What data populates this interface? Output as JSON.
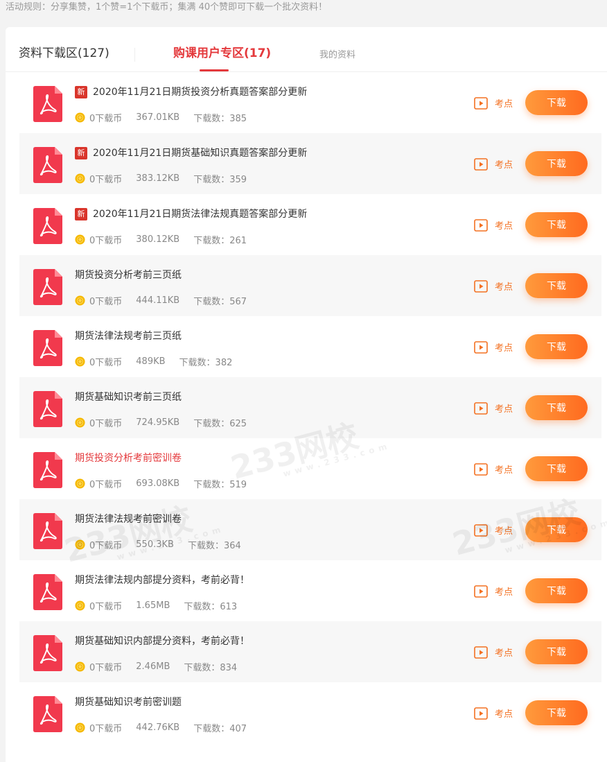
{
  "rule_text": "活动规则：分享集赞，1个赞=1个下载币；集满 40个赞即可下载一个批次资料！",
  "tabs": [
    {
      "label": "资料下载区(127)"
    },
    {
      "label": "购课用户专区(17)"
    },
    {
      "label": "我的资料"
    }
  ],
  "active_tab": 1,
  "item_labels": {
    "new_badge": "新",
    "kaodian": "考点",
    "download": "下载"
  },
  "items": [
    {
      "title": "2020年11月21日期货投资分析真题答案部分更新",
      "is_new": true,
      "hot": false,
      "coins": "0下载币",
      "size": "367.01KB",
      "downloads": "下载数：385"
    },
    {
      "title": "2020年11月21日期货基础知识真题答案部分更新",
      "is_new": true,
      "hot": false,
      "coins": "0下载币",
      "size": "383.12KB",
      "downloads": "下载数：359"
    },
    {
      "title": "2020年11月21日期货法律法规真题答案部分更新",
      "is_new": true,
      "hot": false,
      "coins": "0下载币",
      "size": "380.12KB",
      "downloads": "下载数：261"
    },
    {
      "title": "期货投资分析考前三页纸",
      "is_new": false,
      "hot": false,
      "coins": "0下载币",
      "size": "444.11KB",
      "downloads": "下载数：567"
    },
    {
      "title": "期货法律法规考前三页纸",
      "is_new": false,
      "hot": false,
      "coins": "0下载币",
      "size": "489KB",
      "downloads": "下载数：382"
    },
    {
      "title": "期货基础知识考前三页纸",
      "is_new": false,
      "hot": false,
      "coins": "0下载币",
      "size": "724.95KB",
      "downloads": "下载数：625"
    },
    {
      "title": "期货投资分析考前密训卷",
      "is_new": false,
      "hot": true,
      "coins": "0下载币",
      "size": "693.08KB",
      "downloads": "下载数：519"
    },
    {
      "title": "期货法律法规考前密训卷",
      "is_new": false,
      "hot": false,
      "coins": "0下载币",
      "size": "550.3KB",
      "downloads": "下载数：364"
    },
    {
      "title": "期货法律法规内部提分资料，考前必背！",
      "is_new": false,
      "hot": false,
      "coins": "0下载币",
      "size": "1.65MB",
      "downloads": "下载数：613"
    },
    {
      "title": "期货基础知识内部提分资料，考前必背！",
      "is_new": false,
      "hot": false,
      "coins": "0下载币",
      "size": "2.46MB",
      "downloads": "下载数：834"
    },
    {
      "title": "期货基础知识考前密训题",
      "is_new": false,
      "hot": false,
      "coins": "0下载币",
      "size": "442.76KB",
      "downloads": "下载数：407"
    }
  ],
  "watermark": {
    "main": "233网校",
    "sub": "www.233.com"
  },
  "colors": {
    "accent": "#e4393c",
    "button": "#ff7a2a",
    "badge": "#d9352b",
    "pdf": "#f1394d"
  }
}
